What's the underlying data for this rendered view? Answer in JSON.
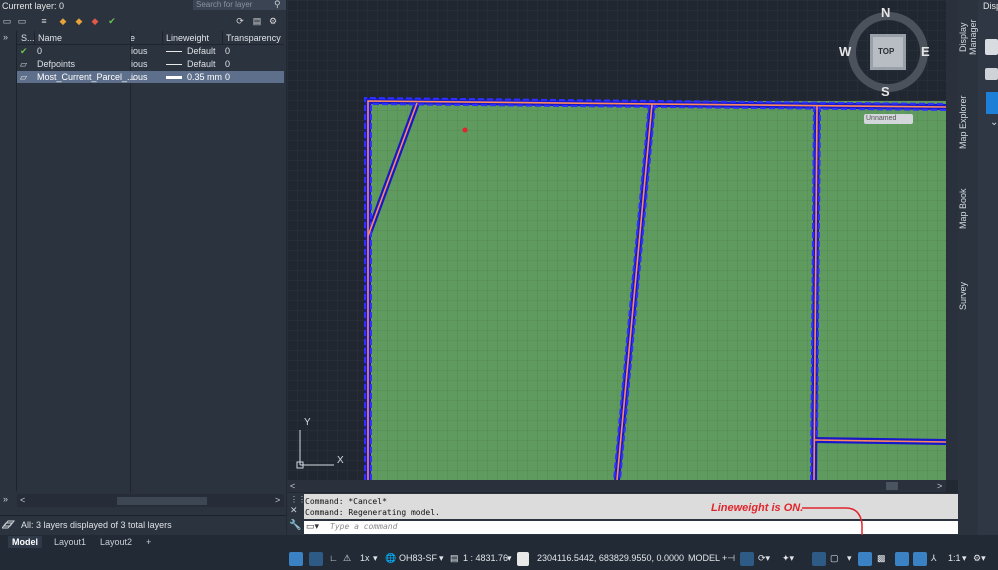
{
  "layer_panel": {
    "current_layer": "Current layer: 0",
    "search_placeholder": "Search for layer",
    "columns": {
      "status": "S...",
      "name": "Name",
      "linetype": "e",
      "lineweight": "Lineweight",
      "transparency": "Transparency"
    },
    "rows": [
      {
        "name": "0",
        "linetype": "ious",
        "lineweight": "Default",
        "transparency": "0"
      },
      {
        "name": "Defpoints",
        "linetype": "ious",
        "lineweight": "Default",
        "transparency": "0"
      },
      {
        "name": "Most_Current_Parcel_...",
        "linetype": "ious",
        "lineweight": "0.35 mm",
        "transparency": "0"
      }
    ],
    "status_text": "All: 3 layers displayed of 3 total layers"
  },
  "viewcube": {
    "north": "N",
    "south": "S",
    "east": "E",
    "west": "W",
    "top": "TOP",
    "view_name": "Unnamed"
  },
  "ucs": {
    "x": "X",
    "y": "Y"
  },
  "right_tabs": [
    "Display Manager",
    "Map Explorer",
    "Map Book",
    "Survey"
  ],
  "right_panel_title": "Disp",
  "command": {
    "history": [
      "Command: *Cancel*",
      "Command: Regenerating model."
    ],
    "placeholder": "Type a command"
  },
  "annotation": "Lineweight is ON.",
  "layout_tabs": [
    "Model",
    "Layout1",
    "Layout2"
  ],
  "add_tab": "+",
  "status_bar": {
    "scale": "1x",
    "coord_system": "OH83-SF",
    "annotation_scale": "1 : 4831.76",
    "coordinates": "2304116.5442, 683829.9550, 0.0000",
    "space": "MODEL",
    "zoom": "1:1"
  },
  "colors": {
    "parcel_fill": "#5f9a5f",
    "parcel_edge": "#1818c8",
    "parcel_line": "#ff8a5c",
    "annotation": "#e0262c"
  }
}
